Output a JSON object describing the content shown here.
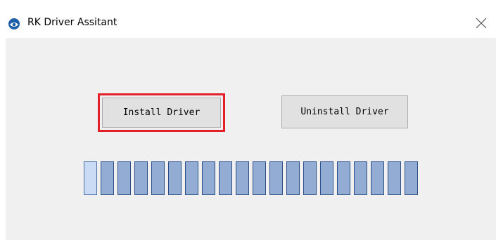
{
  "window": {
    "title": "RK Driver Assitant",
    "app_icon": "rk-app-icon",
    "close_icon": "close-icon"
  },
  "buttons": {
    "install_label": "Install Driver",
    "uninstall_label": "Uninstall Driver"
  },
  "highlight": {
    "color": "#e3202a",
    "target": "install-driver-button"
  },
  "progress": {
    "segments_total": 20,
    "fill_color": "#92acd4",
    "border_color": "#2d4f87"
  }
}
